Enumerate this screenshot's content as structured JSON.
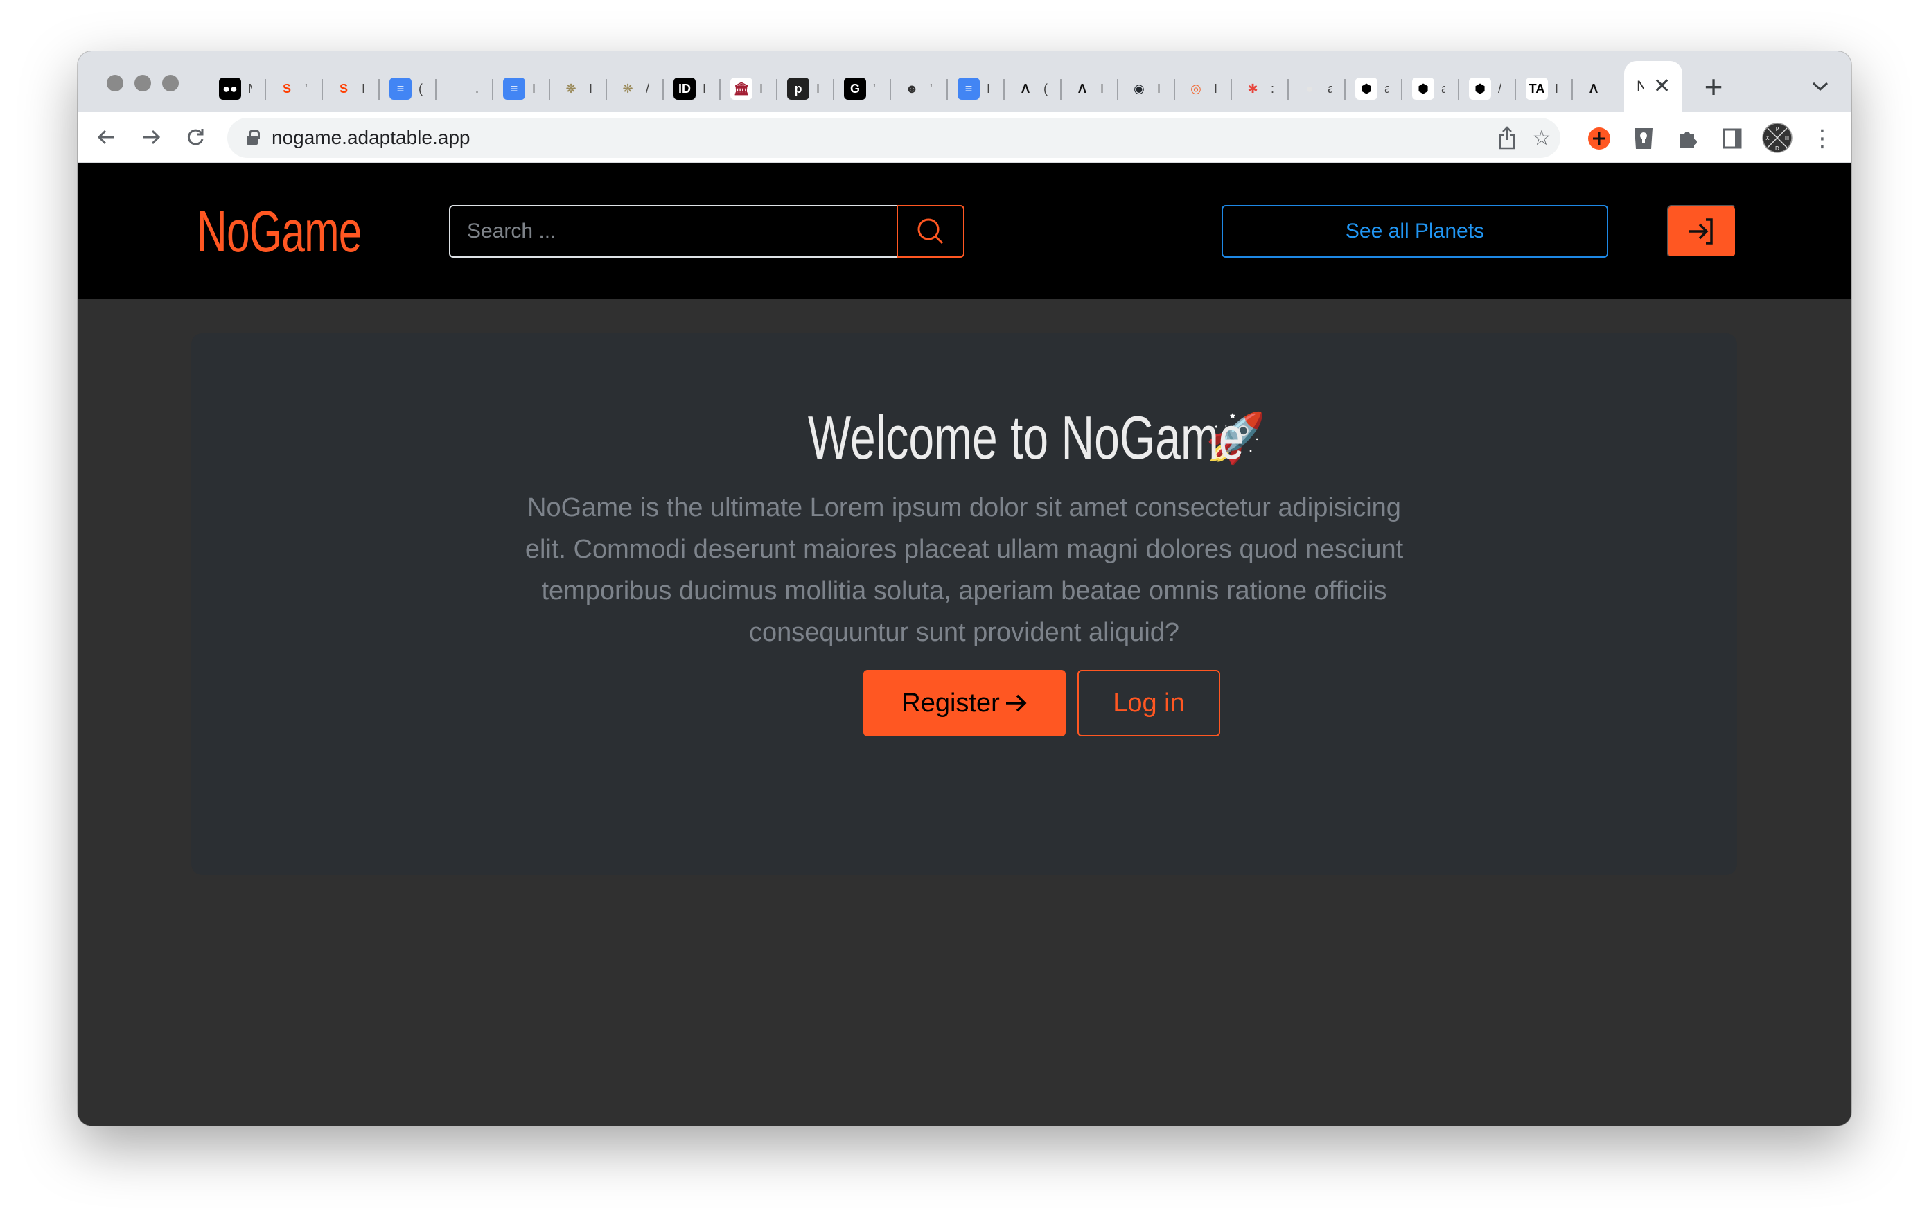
{
  "browser": {
    "tabs": [
      {
        "favicon": "medium-icon",
        "bg": "#000000",
        "glyph": "●●",
        "color": "#ffffff",
        "title": "M"
      },
      {
        "favicon": "svelte-icon",
        "bg": "transparent",
        "glyph": "S",
        "color": "#ff3e00",
        "title": "'"
      },
      {
        "favicon": "svelte-icon",
        "bg": "transparent",
        "glyph": "S",
        "color": "#ff3e00",
        "title": "I"
      },
      {
        "favicon": "google-docs-icon",
        "bg": "#4285f4",
        "glyph": "≡",
        "color": "#ffffff",
        "title": "("
      },
      {
        "favicon": "blank-icon",
        "bg": "transparent",
        "glyph": "",
        "color": "#444444",
        "title": "."
      },
      {
        "favicon": "google-docs-icon",
        "bg": "#4285f4",
        "glyph": "≡",
        "color": "#ffffff",
        "title": "I"
      },
      {
        "favicon": "dots-cluster-icon",
        "bg": "transparent",
        "glyph": "❋",
        "color": "#9a8a5a",
        "title": "I"
      },
      {
        "favicon": "dots-cluster-icon",
        "bg": "transparent",
        "glyph": "❋",
        "color": "#9a8a5a",
        "title": "/"
      },
      {
        "favicon": "ideo-icon",
        "bg": "#000000",
        "glyph": "ID",
        "color": "#ffffff",
        "title": "I"
      },
      {
        "favicon": "museum-icon",
        "bg": "#ffffff",
        "glyph": "🏛",
        "color": "#a31f34",
        "title": "I"
      },
      {
        "favicon": "p-icon",
        "bg": "#222222",
        "glyph": "p",
        "color": "#ffffff",
        "title": "I"
      },
      {
        "favicon": "g-circle-icon",
        "bg": "#000000",
        "glyph": "G",
        "color": "#ffffff",
        "title": "'"
      },
      {
        "favicon": "brain-head-icon",
        "bg": "transparent",
        "glyph": "☻",
        "color": "#333333",
        "title": "'"
      },
      {
        "favicon": "google-docs-icon",
        "bg": "#4285f4",
        "glyph": "≡",
        "color": "#ffffff",
        "title": "I"
      },
      {
        "favicon": "adaptable-icon",
        "bg": "transparent",
        "glyph": "Λ",
        "color": "#111111",
        "title": "("
      },
      {
        "favicon": "adaptable-icon",
        "bg": "transparent",
        "glyph": "Λ",
        "color": "#111111",
        "title": "I"
      },
      {
        "favicon": "github-icon",
        "bg": "transparent",
        "glyph": "◉",
        "color": "#24292f",
        "title": "I"
      },
      {
        "favicon": "ring-icon",
        "bg": "transparent",
        "glyph": "◎",
        "color": "#f06a35",
        "title": "I"
      },
      {
        "favicon": "asterisk-icon",
        "bg": "transparent",
        "glyph": "✱",
        "color": "#e8453c",
        "title": ":"
      },
      {
        "favicon": "sphere-icon",
        "bg": "transparent",
        "glyph": "●",
        "color": "#e4e4e4",
        "title": "a"
      },
      {
        "favicon": "codepen-icon",
        "bg": "#ffffff",
        "glyph": "⬢",
        "color": "#000000",
        "title": "a"
      },
      {
        "favicon": "codepen-icon",
        "bg": "#ffffff",
        "glyph": "⬢",
        "color": "#000000",
        "title": "a"
      },
      {
        "favicon": "codepen-icon",
        "bg": "#ffffff",
        "glyph": "⬢",
        "color": "#000000",
        "title": "/"
      },
      {
        "favicon": "ta-icon",
        "bg": "#ffffff",
        "glyph": "TA",
        "color": "#000000",
        "title": "I"
      },
      {
        "favicon": "adaptable-icon",
        "bg": "transparent",
        "glyph": "Λ",
        "color": "#111111",
        "title": ""
      }
    ],
    "active_tab": {
      "title": "N",
      "close": "✕"
    },
    "new_tab": "+",
    "tab_menu": "⌄",
    "back": "←",
    "forward": "→",
    "reload": "↻",
    "url": "nogame.adaptable.app",
    "share": "⇪",
    "bookmark": "☆",
    "kebab": "⋮"
  },
  "site": {
    "brand": "NoGame",
    "search_placeholder": "Search ...",
    "planets_button": "See all Planets",
    "accent": "#ff5722",
    "link_color": "#2196f3"
  },
  "hero": {
    "title": "Welcome to NoGame",
    "emoji": "🚀",
    "lead": "NoGame is the ultimate Lorem ipsum dolor sit amet consectetur adipisicing elit. Commodi deserunt maiores placeat ullam magni dolores quod nesciunt temporibus ducimus mollitia soluta, aperiam beatae omnis ratione officiis consequuntur sunt provident aliquid?",
    "register_label": "Register",
    "register_arrow": "→",
    "login_label": "Log in"
  }
}
